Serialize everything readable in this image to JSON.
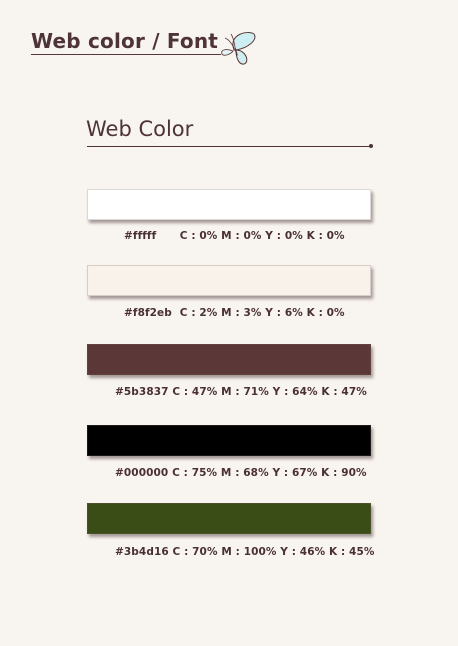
{
  "header": {
    "title": "Web color / Font"
  },
  "section": {
    "title": "Web Color"
  },
  "colors": [
    {
      "hex": "#ffffff",
      "label_hex": "#fffff",
      "cmyk": "C : 0%  M : 0%  Y : 0%  K : 0%"
    },
    {
      "hex": "#f8f2eb",
      "label_hex": "#f8f2eb",
      "cmyk": "C : 2%  M : 3%  Y : 6%  K : 0%"
    },
    {
      "hex": "#5b3837",
      "label_hex": "#5b3837",
      "cmyk": "C : 47%  M : 71%  Y : 64%  K : 47%"
    },
    {
      "hex": "#000000",
      "label_hex": "#000000",
      "cmyk": "C : 75%  M : 68%  Y : 67%  K : 90%"
    },
    {
      "hex": "#3b4d16",
      "label_hex": "#3b4d16",
      "cmyk": "C : 70%  M : 100%  Y : 46%  K : 45%"
    }
  ]
}
